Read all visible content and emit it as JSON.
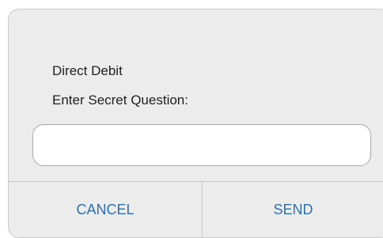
{
  "dialog": {
    "title": "Direct Debit",
    "prompt": "Enter Secret Question:",
    "input": {
      "value": "",
      "placeholder": ""
    },
    "buttons": {
      "cancel_label": "CANCEL",
      "send_label": "SEND"
    }
  },
  "colors": {
    "accent": "#2d6fb3",
    "dialog_background": "#ececec",
    "border": "#c9c9c9"
  }
}
